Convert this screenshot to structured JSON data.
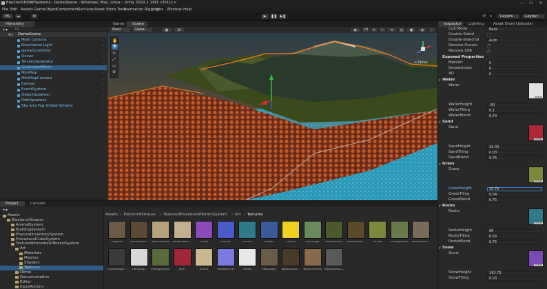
{
  "window": {
    "title": "ElectorchHDRPSystems - DemoScene - Windows, Mac, Linux - Unity 2022.1.16f1 <DX11>",
    "controls": [
      "—",
      "☐",
      "✕"
    ]
  },
  "menu": [
    "File",
    "Edit",
    "Assets",
    "GameObject",
    "Component",
    "Services",
    "Asset Store Tools",
    "Animation Rigging",
    "Jobs",
    "Window",
    "Help"
  ],
  "toolbar": {
    "account": "ES",
    "layers": "Layers",
    "layout": "Layout"
  },
  "hierarchy": {
    "tab": "Hierarchy",
    "search_placeholder": "All",
    "scene": "DemoScene",
    "items": [
      "Main Camera",
      "Directional Light",
      "GameController",
      "Ocean",
      "TerrainGenerator",
      "GeneratedMesh",
      "MiniMap",
      "MiniMapCamera",
      "Canvas",
      "EventSystem",
      "ObjectSpawner",
      "PathSpawner",
      "Sky and Fog Global Volume"
    ]
  },
  "scene_view": {
    "tabs": [
      "Game",
      "Scene"
    ],
    "pivot": "Pivot",
    "global": "Global",
    "persp": "< Persp"
  },
  "project": {
    "tabs": [
      "Project",
      "Console"
    ],
    "tree": [
      {
        "label": "Assets",
        "indent": 0
      },
      {
        "label": "ElectorchStrauss",
        "indent": 1
      },
      {
        "label": "AnimalSystem",
        "indent": 2
      },
      {
        "label": "BuildingSystem",
        "indent": 2
      },
      {
        "label": "PhysicalInventorySystem",
        "indent": 2
      },
      {
        "label": "ProceduralCubeSystem",
        "indent": 2
      },
      {
        "label": "TexturedProceduralTerrainSystem",
        "indent": 2
      },
      {
        "label": "Art",
        "indent": 3
      },
      {
        "label": "Materials",
        "indent": 4
      },
      {
        "label": "Meshes",
        "indent": 4
      },
      {
        "label": "Shaders",
        "indent": 4
      },
      {
        "label": "Textures",
        "indent": 4
      },
      {
        "label": "Demo",
        "indent": 3
      },
      {
        "label": "Documentation",
        "indent": 3
      },
      {
        "label": "Editor",
        "indent": 3
      },
      {
        "label": "InputActions",
        "indent": 3
      }
    ],
    "breadcrumb": [
      "Assets",
      "ElectorchStrauss",
      "TexturedProceduralTerrainSystem",
      "Art",
      "Textures"
    ],
    "assets_row1": [
      {
        "name": "Asphalt",
        "color": "#6b5a45"
      },
      {
        "name": "BarkBeech",
        "color": "#5a4a36"
      },
      {
        "name": "BeachSand",
        "color": "#b8a27a"
      },
      {
        "name": "BeachSan...",
        "color": "#c2b08e"
      },
      {
        "name": "Coral",
        "color": "#8a4ab8"
      },
      {
        "name": "Coral1",
        "color": "#4a5ac8"
      },
      {
        "name": "Coral2",
        "color": "#2e7a8a"
      },
      {
        "name": "Coral3",
        "color": "#3a5a9a"
      },
      {
        "name": "Cursor",
        "color": "#f0d020"
      },
      {
        "name": "ElecLogo",
        "color": "#6a8a5a"
      },
      {
        "name": "ForestMoss",
        "color": "#4a5a2a"
      },
      {
        "name": "ForestLea...",
        "color": "#5a4a2a"
      },
      {
        "name": "Grass",
        "color": "#7a8a3a"
      },
      {
        "name": "GrassyRock",
        "color": "#6a7a4a"
      },
      {
        "name": "Hardened...",
        "color": "#7a6a5a"
      }
    ],
    "assets_row2": [
      {
        "name": "IconImage...",
        "color": "#3a3a3a"
      },
      {
        "name": "MiniMap",
        "color": "#d8d8d8"
      },
      {
        "name": "MossyStains",
        "color": "#5a6a3a"
      },
      {
        "name": "SciFi",
        "color": "#a02838"
      },
      {
        "name": "SciFi1",
        "color": "#c8b890"
      },
      {
        "name": "SeaNormal",
        "color": "#7a7ae0"
      },
      {
        "name": "Snow",
        "color": "#e8e8e8"
      },
      {
        "name": "WetSand",
        "color": "#6a5a48"
      },
      {
        "name": "WoodChar...",
        "color": "#4a3a2a"
      },
      {
        "name": "WoodPanels",
        "color": "#8a6a4a"
      },
      {
        "name": "WoodWalls...",
        "color": "#5a5a5a"
      }
    ]
  },
  "inspector": {
    "tabs": [
      "Inspector",
      "Lighting",
      "Asset Store Uploader"
    ],
    "props_top": [
      {
        "label": "Cull Mode",
        "value": "Back",
        "type": "dropdown"
      },
      {
        "label": "Double-Sided",
        "value": "",
        "type": "check"
      },
      {
        "label": "Double-Sided GI",
        "value": "Auto",
        "type": "dropdown"
      },
      {
        "label": "Receive Decals",
        "value": "",
        "type": "check-on"
      },
      {
        "label": "Receive SSR",
        "value": "",
        "type": "check-on"
      }
    ],
    "exposed_title": "Exposed Properties",
    "exposed": [
      {
        "label": "Metallic",
        "value": "0"
      },
      {
        "label": "Smoothness",
        "value": "0"
      },
      {
        "label": "AO",
        "value": "0"
      }
    ],
    "sections": [
      {
        "title": "Water",
        "tex_label": "Water",
        "tex_color": "#e4e4e4",
        "fields": [
          {
            "label": "WaterHeight",
            "value": "-30"
          },
          {
            "label": "WaterTiling",
            "value": "0.1"
          },
          {
            "label": "WaterBlend",
            "value": "0.74"
          }
        ]
      },
      {
        "title": "Sand",
        "tex_label": "Sand",
        "tex_color": "#b02838",
        "fields": [
          {
            "label": "SandHeight",
            "value": "33.43"
          },
          {
            "label": "SandTiling",
            "value": "0.03"
          },
          {
            "label": "SandBlend",
            "value": "0.75"
          }
        ]
      },
      {
        "title": "Grass",
        "tex_label": "Grass",
        "tex_color": "#7a8a3a",
        "fields": [
          {
            "label": "GrassHeight",
            "value": "35.75"
          },
          {
            "label": "GrassTiling",
            "value": "0.04"
          },
          {
            "label": "GrassBlend",
            "value": "0.75"
          }
        ]
      },
      {
        "title": "Rocks",
        "tex_label": "Rocks",
        "tex_color": "#2e7a8a",
        "fields": [
          {
            "label": "RocksHeight",
            "value": "60"
          },
          {
            "label": "RocksTiling",
            "value": "0.03"
          },
          {
            "label": "RocksBlend",
            "value": "0.75"
          }
        ]
      },
      {
        "title": "Snow",
        "tex_label": "Snow",
        "tex_color": "#7a4ab8",
        "fields": [
          {
            "label": "SnowHeight",
            "value": "193.73"
          },
          {
            "label": "SnowTiling",
            "value": "0.03"
          }
        ]
      }
    ],
    "select_label": "Select"
  }
}
